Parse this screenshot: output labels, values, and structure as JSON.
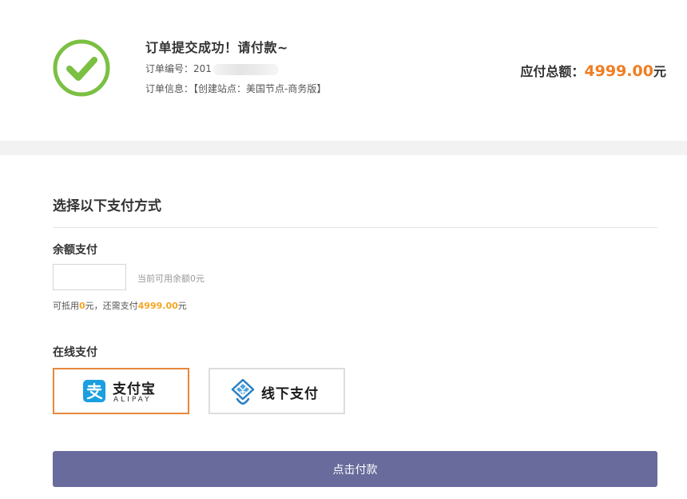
{
  "order": {
    "title": "订单提交成功！请付款~",
    "number_label": "订单编号：",
    "number_visible": "201",
    "info_label": "订单信息：",
    "info_value": "【创建站点：美国节点-商务版】",
    "total_label": "应付总额：",
    "total_amount": "4999.00",
    "total_unit": "元"
  },
  "payment": {
    "section_title": "选择以下支付方式",
    "balance": {
      "label": "余额支付",
      "input_value": "",
      "hint": "当前可用余额0元",
      "deduct_prefix": "可抵用",
      "deduct_amount": "0",
      "deduct_middle": "元，还需支付",
      "remaining_amount": "4999.00",
      "deduct_suffix": "元"
    },
    "online": {
      "label": "在线支付",
      "alipay_cn": "支付宝",
      "alipay_en": "ALIPAY",
      "offline": "线下支付"
    },
    "submit_label": "点击付款"
  },
  "colors": {
    "success": "#7bc043",
    "amount": "#f07d21",
    "highlight": "#f5a623",
    "selected_border": "#e8873d",
    "alipay_blue": "#1a9fe0",
    "button": "#696b9c"
  },
  "icons": {
    "success": "check-circle-icon",
    "alipay": "alipay-logo-icon",
    "offline": "offline-pay-icon"
  }
}
